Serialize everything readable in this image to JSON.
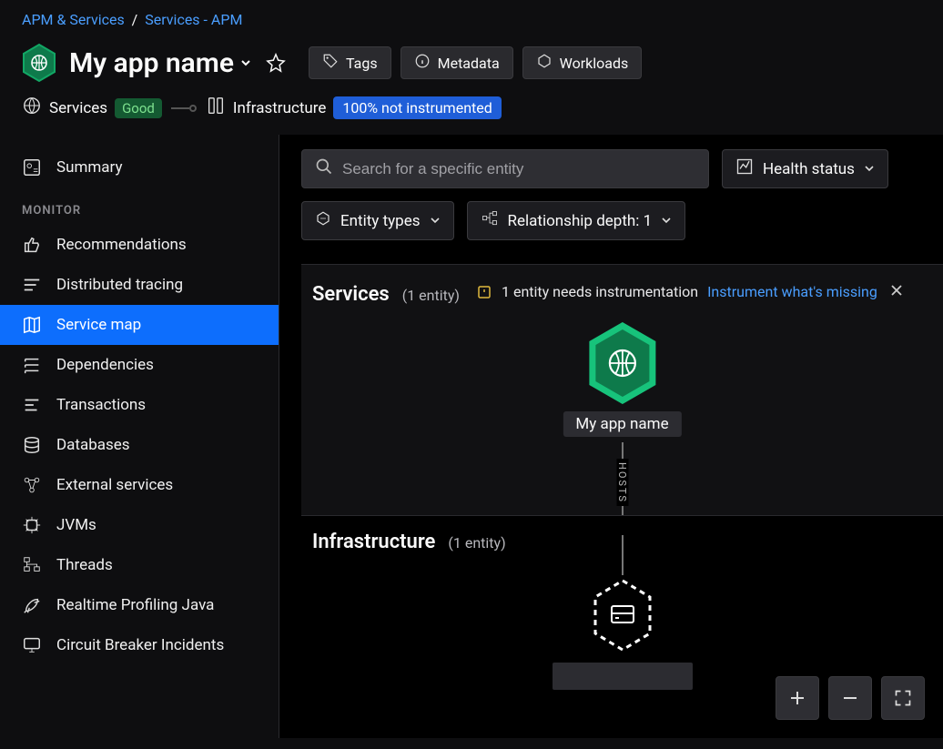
{
  "breadcrumb": {
    "a": "APM & Services",
    "b": "Services - APM"
  },
  "header": {
    "title": "My app name",
    "chips": {
      "tags": "Tags",
      "metadata": "Metadata",
      "workloads": "Workloads"
    }
  },
  "status": {
    "services_label": "Services",
    "services_badge": "Good",
    "infra_label": "Infrastructure",
    "infra_badge": "100% not instrumented"
  },
  "sidebar": {
    "summary": "Summary",
    "monitor_label": "MONITOR",
    "items": {
      "recommendations": "Recommendations",
      "distributed": "Distributed tracing",
      "service_map": "Service map",
      "dependencies": "Dependencies",
      "transactions": "Transactions",
      "databases": "Databases",
      "external": "External services",
      "jvms": "JVMs",
      "threads": "Threads",
      "profiling": "Realtime Profiling Java",
      "circuit": "Circuit Breaker Incidents"
    }
  },
  "toolbar": {
    "search_placeholder": "Search for a specific entity",
    "health": "Health status",
    "entity_types": "Entity types",
    "relationship": "Relationship depth: 1"
  },
  "pane_services": {
    "title": "Services",
    "count": "(1 entity)",
    "warn_text": "1 entity needs instrumentation",
    "warn_link": "Instrument what's missing",
    "node_label": "My app name",
    "edge_label": "HOSTS"
  },
  "pane_infra": {
    "title": "Infrastructure",
    "count": "(1 entity)"
  }
}
